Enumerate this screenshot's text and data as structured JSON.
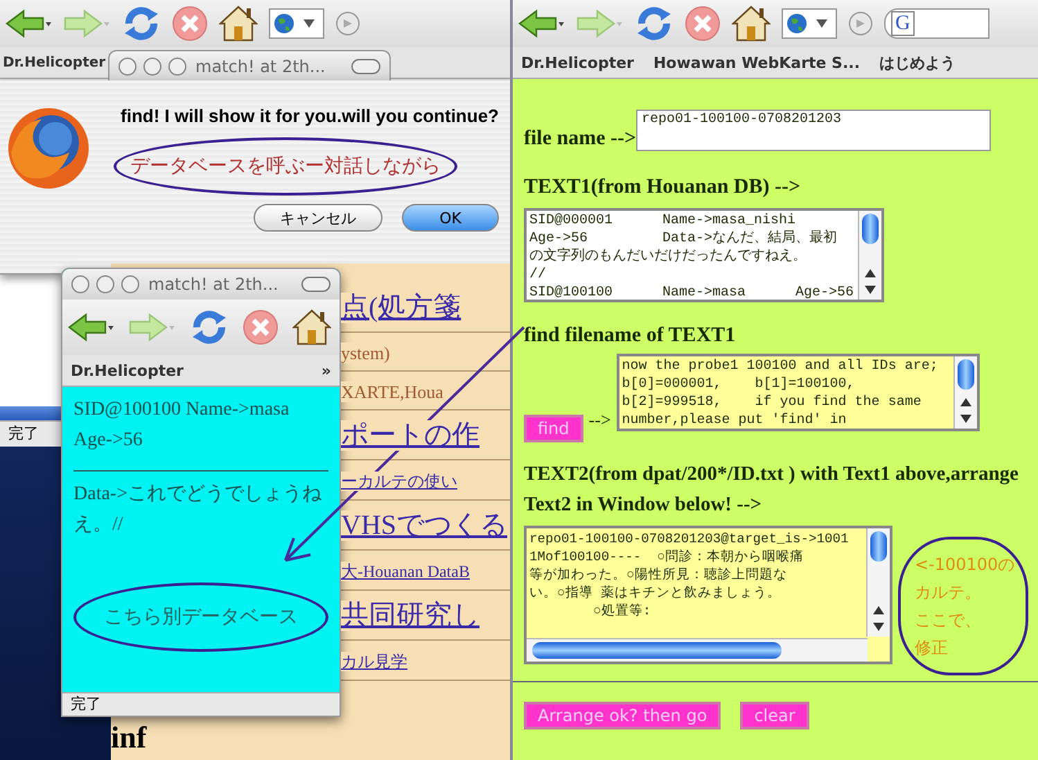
{
  "back_window": {
    "bookmarks": [
      "Dr.Helicopter"
    ]
  },
  "dialog": {
    "title": "match! at 2th...",
    "message": "find! I will show it for you.will you continue?",
    "note": "データベースを呼ぶー対話しながら",
    "buttons": [
      {
        "label": "キャンセル",
        "default": false
      },
      {
        "label": "OK",
        "default": true
      }
    ]
  },
  "status_window": {
    "status": "完了"
  },
  "links_window": {
    "links": [
      {
        "text": "点(処方箋",
        "kind": "large"
      },
      {
        "text": "ystem)",
        "kind": "plain"
      },
      {
        "text": "XARTE,Houa",
        "kind": "plain"
      },
      {
        "text": "ポートの作",
        "kind": "large"
      },
      {
        "text": "ーカルテの使い",
        "kind": "small"
      },
      {
        "text": "VHSでつくる",
        "kind": "large"
      },
      {
        "text": "大-Houanan DataB",
        "kind": "small"
      },
      {
        "text": "共同研究し",
        "kind": "large"
      },
      {
        "text": "カル見学",
        "kind": "small"
      }
    ],
    "heading": "inf"
  },
  "popup": {
    "title": "match! at 2th...",
    "bookmarks": [
      "Dr.Helicopter"
    ],
    "overflow_mark": "»",
    "header": "SID@100100 Name->masa Age->56",
    "data": "Data->これでどうでしょうねえ。//",
    "note": "こちら別データベース",
    "status": "完了"
  },
  "main_window": {
    "bookmarks": [
      "Dr.Helicopter",
      "Howawan WebKarte S...",
      "はじめよう"
    ],
    "search_logo": "G",
    "file_label": "file name -->",
    "file_name": "repo01-100100-0708201203",
    "text1_heading": "TEXT1(from Houanan DB) -->",
    "text1_lines": [
      "SID@000001      Name->masa_nishi",
      "Age->56         Data->なんだ、結局、最初",
      "の文字列のもんだいだけだったんですねえ。",
      "//",
      "SID@100100      Name->masa      Age->56"
    ],
    "find_heading": "find filename of TEXT1",
    "find_button": "find",
    "find_arrow": "-->",
    "probe_lines": [
      "now the probe1 100100 and all IDs are;",
      "b[0]=000001,    b[1]=100100,",
      "b[2]=999518,    if you find the same",
      "number,please put 'find' in"
    ],
    "text2_heading": "TEXT2(from dpat/200*/ID.txt ) with Text1 above,arrange Text2 in Window below! -->",
    "text2_lines": [
      "repo01-100100-0708201203@target_is->1001",
      "1Mof100100----  ○問診：本朝から咽喉痛",
      "等が加わった。○陽性所見：聴診上問題な",
      "い。○指導 薬はキチンと飲みましょう。",
      "        ○処置等:"
    ],
    "note_lines": [
      "<-100100の",
      "カルテ。",
      "ここで、",
      "修正"
    ],
    "buttons": [
      "Arrange ok? then go",
      "clear"
    ]
  }
}
